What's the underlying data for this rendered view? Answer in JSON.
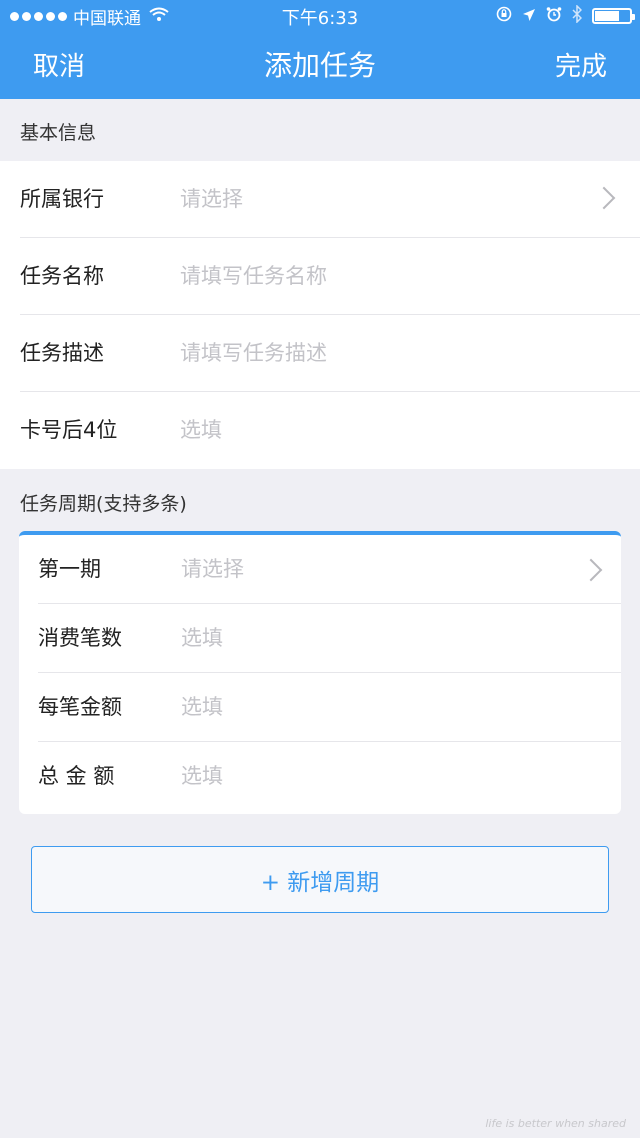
{
  "status_bar": {
    "carrier": "中国联通",
    "time": "下午6:33",
    "battery_level": 0.65
  },
  "nav": {
    "cancel": "取消",
    "title": "添加任务",
    "done": "完成"
  },
  "basic_info": {
    "section_title": "基本信息",
    "rows": [
      {
        "label": "所属银行",
        "placeholder": "请选择"
      },
      {
        "label": "任务名称",
        "placeholder": "请填写任务名称"
      },
      {
        "label": "任务描述",
        "placeholder": "请填写任务描述"
      },
      {
        "label": "卡号后4位",
        "placeholder": "选填"
      }
    ]
  },
  "period": {
    "section_title": "任务周期(支持多条)",
    "rows": [
      {
        "label": "第一期",
        "placeholder": "请选择"
      },
      {
        "label": "消费笔数",
        "placeholder": "选填"
      },
      {
        "label": "每笔金额",
        "placeholder": "选填"
      },
      {
        "label": "总 金 额",
        "placeholder": "选填"
      }
    ],
    "add_button": "+ 新增周期"
  },
  "watermark": "life is better when shared",
  "colors": {
    "accent": "#3e9bf0",
    "background": "#efeff4",
    "placeholder": "#c3c3c8"
  }
}
